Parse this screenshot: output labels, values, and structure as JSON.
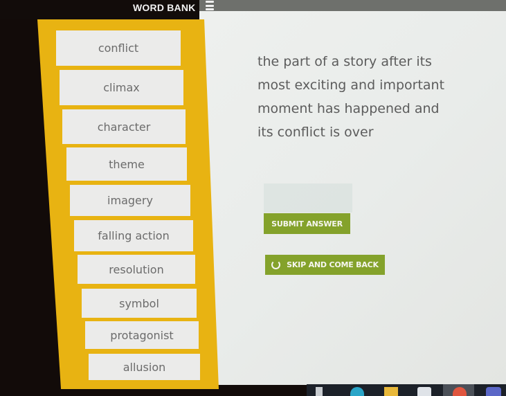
{
  "header": {
    "title": "WORD BANK",
    "menu_icon": "hamburger-menu-icon"
  },
  "word_bank": {
    "words": [
      "conflict",
      "climax",
      "character",
      "theme",
      "imagery",
      "falling action",
      "resolution",
      "symbol",
      "protagonist",
      "allusion"
    ]
  },
  "question": {
    "definition": "the part of a story after its most exciting and important moment has happened and its conflict is over"
  },
  "actions": {
    "submit_label": "SUBMIT ANSWER",
    "skip_label": "SKIP AND COME BACK",
    "skip_icon": "refresh-icon"
  },
  "colors": {
    "word_bank_bg": "#e8b312",
    "button_green": "#84a22b",
    "header_dark": "#120c0a"
  },
  "taskbar": {
    "icons": [
      "file-explorer-icon",
      "edge-icon",
      "folder-icon",
      "store-icon",
      "chrome-icon",
      "teams-icon"
    ]
  }
}
